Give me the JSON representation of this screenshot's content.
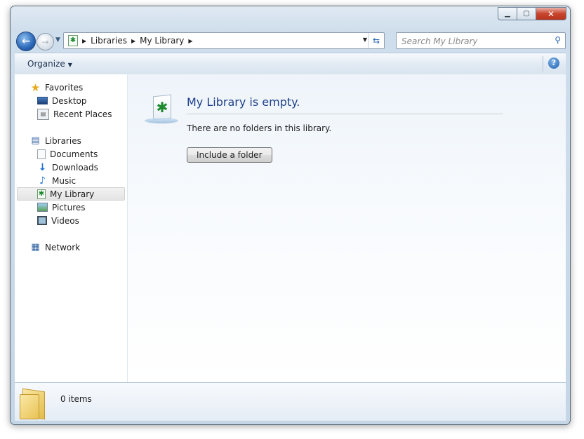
{
  "window": {
    "caption_buttons": {
      "minimize": "▁",
      "maximize": "▢",
      "close": "✕"
    }
  },
  "navigation": {
    "back_icon": "back-arrow",
    "forward_icon": "forward-arrow",
    "address": {
      "icon": "library-icon",
      "breadcrumbs": [
        "Libraries",
        "My Library"
      ]
    },
    "search": {
      "placeholder": "Search My Library"
    }
  },
  "toolbar": {
    "organize_label": "Organize",
    "help_label": "?"
  },
  "sidebar": {
    "favorites": {
      "label": "Favorites",
      "items": [
        {
          "label": "Desktop",
          "icon": "desktop-icon"
        },
        {
          "label": "Recent Places",
          "icon": "recent-places-icon"
        }
      ]
    },
    "libraries": {
      "label": "Libraries",
      "items": [
        {
          "label": "Documents",
          "icon": "documents-icon"
        },
        {
          "label": "Downloads",
          "icon": "downloads-icon"
        },
        {
          "label": "Music",
          "icon": "music-icon"
        },
        {
          "label": "My Library",
          "icon": "library-icon",
          "selected": true
        },
        {
          "label": "Pictures",
          "icon": "pictures-icon"
        },
        {
          "label": "Videos",
          "icon": "videos-icon"
        }
      ]
    },
    "network": {
      "label": "Network",
      "icon": "network-icon"
    }
  },
  "main": {
    "title": "My Library is empty.",
    "message": "There are no folders in this library.",
    "button_label": "Include a folder"
  },
  "details": {
    "item_count": "0 items"
  },
  "colors": {
    "title_blue": "#1e3f8a",
    "frame": "#c5d6e7",
    "selection": "#e4e4e4"
  }
}
